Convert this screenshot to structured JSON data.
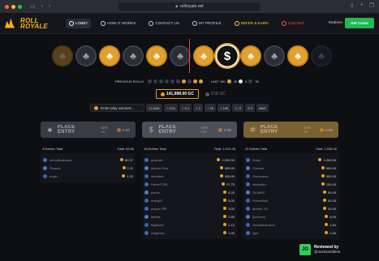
{
  "browser": {
    "url": "rollroyale.net",
    "traffic_colors": [
      "#fe5f57",
      "#febc2e",
      "#28c840"
    ]
  },
  "header": {
    "logo_top": "ROLL",
    "logo_bottom": "ROYALE",
    "nav": [
      {
        "label": "LOBBY",
        "icon": "home-icon"
      },
      {
        "label": "HOW IT WORKS",
        "icon": "question-icon"
      },
      {
        "label": "CONTACT US",
        "icon": "mail-icon"
      },
      {
        "label": "MY PROFILE",
        "icon": "user-icon"
      },
      {
        "label": "REFER & EARN",
        "icon": "gift-icon"
      },
      {
        "label": "LOG OUT",
        "icon": "logout-icon"
      }
    ],
    "redeem_label": "Redeem",
    "get_coins_label": "Get Coins"
  },
  "wheel": {
    "chips": [
      "gold",
      "grey",
      "gold",
      "grey",
      "gold",
      "grey",
      "gold",
      "grey",
      "gold",
      "grey",
      "gold",
      "grey",
      "gold",
      "grey",
      "gold",
      "grey",
      "gold",
      "grey",
      "gold",
      "grey",
      "gold",
      "grey",
      "gold",
      "grey"
    ],
    "winning_symbol": "$",
    "club_symbol": "♣"
  },
  "previous_rolls": {
    "label": "PREVIOUS ROLLS",
    "last_label": "LAST 100",
    "counts": [
      "49",
      "0",
      "39"
    ]
  },
  "balance": {
    "gc": "141,998.00 GC",
    "sc": "0.00 SC"
  },
  "bet": {
    "placeholder": "Enter play amount...",
    "buttons": [
      "CLEAR",
      "+ 0.01",
      "+ 0.1",
      "+ 1",
      "+ 10",
      "+ 100",
      "1 / 2",
      "X 2",
      "MAX"
    ]
  },
  "columns": [
    {
      "title": "PLACE ENTRY",
      "win": "WIN 2x",
      "amount": "0.00",
      "icon": "♣",
      "bar_color": "#3a3c44",
      "entries_total": "3 Entries Total",
      "total": "Total: 63.80",
      "entries": [
        {
          "name": "chrisalikaimana",
          "bet": "60.37",
          "avatar": "#3a6fb5"
        },
        {
          "name": "Ricardo",
          "bet": "2.11",
          "avatar": "#4b7fc6"
        },
        {
          "name": "dustn",
          "bet": "1.32",
          "avatar": "#3b66a8"
        }
      ]
    },
    {
      "title": "PLACE ENTRY",
      "win": "WIN 14x",
      "amount": "0.00",
      "icon": "$",
      "bar_color": "#4c4f57",
      "entries_total": "16 Entries Total",
      "total": "Total: 2,012.35",
      "entries": [
        {
          "name": "gowrath",
          "bet": "1,000.00",
          "avatar": "#3a6fb5"
        },
        {
          "name": "Marcio Cruz",
          "bet": "500.00",
          "avatar": "#4b7fc6"
        },
        {
          "name": "drexdbet",
          "bet": "200.00",
          "avatar": "#3b66a8"
        },
        {
          "name": "Daniel7785",
          "bet": "27.75",
          "avatar": "#3a6fb5"
        },
        {
          "name": "parcio",
          "bet": "6.20",
          "avatar": "#4b7fc6"
        },
        {
          "name": "mangiG",
          "bet": "5.00",
          "avatar": "#3b66a8"
        },
        {
          "name": "pepper RR",
          "bet": "3.00",
          "avatar": "#3a6fb5"
        },
        {
          "name": "fastdie",
          "bet": "2.50",
          "avatar": "#4b7fc6"
        },
        {
          "name": "Bigfoutel",
          "bet": "1.12",
          "avatar": "#3b66a8"
        },
        {
          "name": "rickjames",
          "bet": "1.00",
          "avatar": "#3a6fb5"
        }
      ]
    },
    {
      "title": "PLACE ENTRY",
      "win": "WIN 2x",
      "amount": "0.00",
      "icon": "✲",
      "bar_color": "#7a6130",
      "entries_total": "11 Entries Total",
      "total": "Total: 2,038.30",
      "entries": [
        {
          "name": "Emily",
          "bet": "1,000.00",
          "avatar": "#3a6fb5"
        },
        {
          "name": "Chessie",
          "bet": "500.00",
          "avatar": "#4b7fc6"
        },
        {
          "name": "Ciscocarso",
          "bet": "300.00",
          "avatar": "#3b66a8"
        },
        {
          "name": "cricketjim",
          "bet": "100.00",
          "avatar": "#3a6fb5"
        },
        {
          "name": "GLAMIS",
          "bet": "50.00",
          "avatar": "#4b7fc6"
        },
        {
          "name": "PrinceWall",
          "bet": "40.00",
          "avatar": "#3b66a8"
        },
        {
          "name": "athlete_00",
          "bet": "32.00",
          "avatar": "#3a6fb5"
        },
        {
          "name": "jkmames",
          "bet": "8.00",
          "avatar": "#4b7fc6"
        },
        {
          "name": "chrisalikaimana",
          "bet": "1.84",
          "avatar": "#3b66a8"
        },
        {
          "name": "tiger",
          "bet": "0.46",
          "avatar": "#3a6fb5"
        }
      ]
    }
  ],
  "badge": {
    "logo": "JG",
    "line1": "Reviewed by",
    "line2": "@JustGamblers"
  }
}
